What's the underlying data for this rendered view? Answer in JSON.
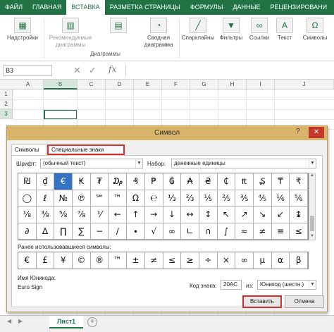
{
  "ribbon_tabs": [
    "ФАЙЛ",
    "ГЛАВНАЯ",
    "ВСТАВКА",
    "РАЗМЕТКА СТРАНИЦЫ",
    "ФОРМУЛЫ",
    "ДАННЫЕ",
    "РЕЦЕНЗИРОВАНИ"
  ],
  "active_tab": "ВСТАВКА",
  "ribbon": {
    "addins": "Надстройки",
    "rec_charts": "Рекомендуемые диаграммы",
    "pivot_chart": "Сводная диаграмма",
    "sparklines": "Спарклайны",
    "filters": "Фильтры",
    "links": "Ссылки",
    "text": "Текст",
    "symbols": "Символы",
    "charts_group": "Диаграммы"
  },
  "formula_bar": {
    "name_box": "B3",
    "fx": "fx"
  },
  "grid": {
    "columns": [
      "A",
      "B",
      "C",
      "D",
      "E",
      "F",
      "G",
      "H",
      "I",
      "J"
    ],
    "rows": [
      "1",
      "2",
      "3"
    ]
  },
  "sheet_tab": "Лист1",
  "dialog": {
    "title": "Символ",
    "help": "?",
    "close": "✕",
    "tab_symbols": "Символы",
    "tab_special": "Специальные знаки",
    "font_label": "Шрифт:",
    "font_value": "(обычный текст)",
    "subset_label": "Набор:",
    "subset_value": "денежные единицы",
    "symbols": [
      [
        "₪",
        "₫",
        "€",
        "₭",
        "₮",
        "₯",
        "₰",
        "₱",
        "₲",
        "₳",
        "₴",
        "₵",
        "₶",
        "₷",
        "₸",
        "₹"
      ],
      [
        "◯",
        "ℓ",
        "№",
        "℗",
        "℠",
        "™",
        "Ω",
        "℮",
        "⅓",
        "⅔",
        "⅕",
        "⅖",
        "⅗",
        "⅘",
        "⅙",
        "⅚"
      ],
      [
        "⅛",
        "⅜",
        "⅝",
        "⅞",
        "⅟",
        "←",
        "↑",
        "→",
        "↓",
        "↔",
        "↕",
        "↖",
        "↗",
        "↘",
        "↙",
        "↨"
      ],
      [
        "∂",
        "∆",
        "∏",
        "∑",
        "−",
        "∕",
        "∙",
        "√",
        "∞",
        "∟",
        "∩",
        "∫",
        "≈",
        "≠",
        "≡",
        "≤"
      ]
    ],
    "recent_label": "Ранее использовавшиеся символы:",
    "recent": [
      "€",
      "£",
      "¥",
      "©",
      "®",
      "™",
      "±",
      "≠",
      "≤",
      "≥",
      "÷",
      "×",
      "∞",
      "µ",
      "α",
      "β"
    ],
    "unicode_label": "Имя Юникода:",
    "unicode_name": "Euro Sign",
    "code_label": "Код знака:",
    "code_value": "20AC",
    "from_label": "из:",
    "from_value": "Юникод (шестн.)",
    "insert": "Вставить",
    "cancel": "Отмена"
  }
}
